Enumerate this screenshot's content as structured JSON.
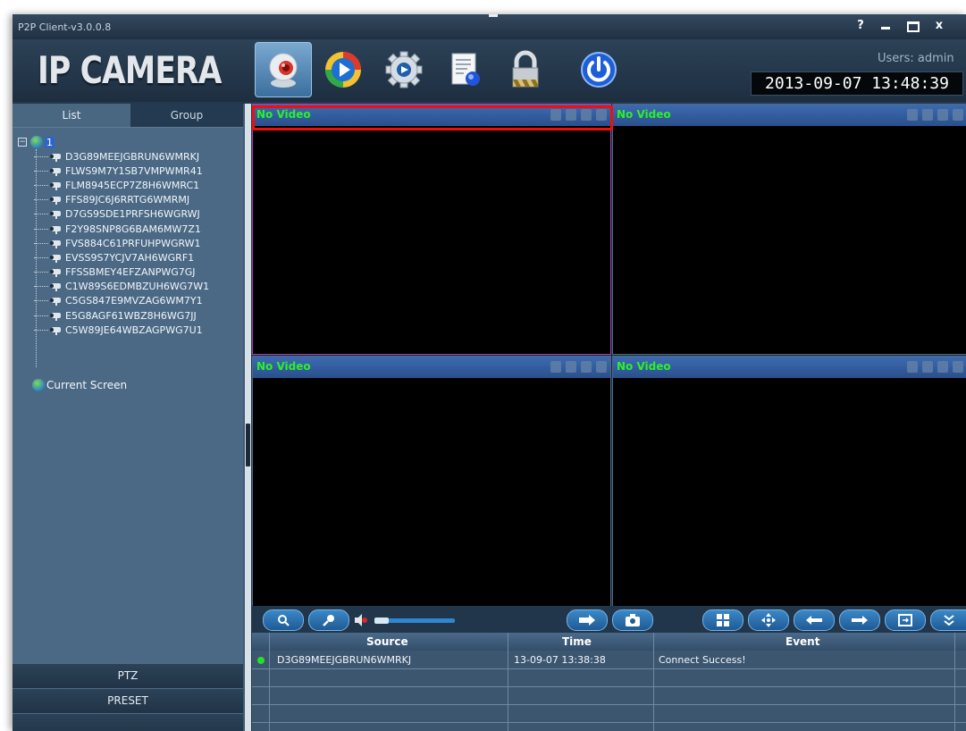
{
  "window": {
    "title": "P2P Client-v3.0.0.8",
    "help_label": "?",
    "close_label": "x"
  },
  "header": {
    "logo": "IP CAMERA",
    "users": "Users: admin",
    "datetime": "2013-09-07 13:48:39",
    "toolbar": [
      {
        "icon": "webcam-icon",
        "active": true
      },
      {
        "icon": "playback-icon",
        "active": false
      },
      {
        "icon": "settings-gear-icon",
        "active": false
      },
      {
        "icon": "log-document-icon",
        "active": false
      },
      {
        "icon": "lock-icon",
        "active": false
      },
      {
        "icon": "power-icon",
        "active": false
      }
    ]
  },
  "sidebar": {
    "tabs": {
      "list": "List",
      "group": "Group"
    },
    "root_label": "1",
    "devices": [
      "D3G89MEEJGBRUN6WMRKJ",
      "FLWS9M7Y1SB7VMPWMR41",
      "FLM8945ECP7Z8H6WMRC1",
      "FFS89JC6J6RRTG6WMRMJ",
      "D7GS9SDE1PRFSH6WGRWJ",
      "F2Y98SNP8G6BAM6MW7Z1",
      "FVS884C61PRFUHPWGRW1",
      "EVSS9S7YCJV7AH6WGRF1",
      "FFSSBMEY4EFZANPWG7GJ",
      "C1W89S6EDMBZUH6WG7W1",
      "C5GS847E9MVZAG6WM7Y1",
      "E5G8AGF61WBZ8H6WG7JJ",
      "C5W89JE64WBZAGPWG7U1"
    ],
    "current_screen": "Current Screen",
    "buttons": {
      "ptz": "PTZ",
      "preset": "PRESET"
    }
  },
  "video": {
    "cells": [
      {
        "label": "No Video"
      },
      {
        "label": "No Video"
      },
      {
        "label": "No Video"
      },
      {
        "label": "No Video"
      }
    ],
    "volume_level": 0.18
  },
  "events": {
    "headers": {
      "source": "Source",
      "time": "Time",
      "event": "Event"
    },
    "rows": [
      {
        "source": "D3G89MEEJGBRUN6WMRKJ",
        "time": "13-09-07 13:38:38",
        "event": "Connect Success!",
        "status_color": "#26e028"
      }
    ]
  },
  "colors": {
    "no_video_text": "#2cef2c",
    "selection_outline": "#f00f0f",
    "accent_blue": "#2f86d0"
  }
}
